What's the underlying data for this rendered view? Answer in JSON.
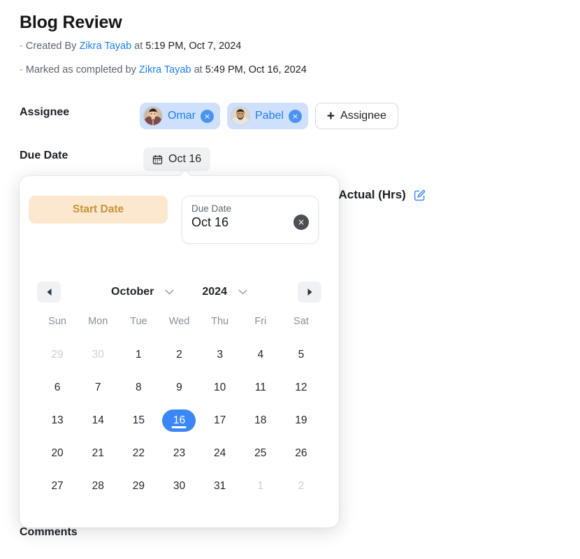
{
  "header": {
    "title": "Blog Review",
    "created": {
      "dash": "-",
      "prefix": "Created By",
      "user": "Zikra Tayab",
      "mid": "at",
      "date": "5:19 PM, Oct 7, 2024"
    },
    "completed": {
      "dash": "-",
      "prefix": "Marked as completed by",
      "user": "Zikra Tayab",
      "mid": "at",
      "date": "5:49 PM, Oct 16, 2024"
    }
  },
  "fields": {
    "assignee_label": "Assignee",
    "due_date_label": "Due Date",
    "assignees": [
      {
        "name": "Omar",
        "remove_label": "×",
        "avatar": "omar-avatar"
      },
      {
        "name": "Pabel",
        "remove_label": "×",
        "avatar": "pabel-avatar"
      }
    ],
    "add_assignee_label": "Assignee",
    "add_assignee_plus": "+",
    "due_date_value": "Oct 16"
  },
  "tracking": {
    "label": "g Actual (Hrs)",
    "edit_icon": "edit-icon"
  },
  "comments_label": "Comments",
  "datepicker": {
    "start_date_label": "Start Date",
    "due_date_card": {
      "label": "Due Date",
      "value": "Oct 16",
      "clear_label": "×"
    },
    "nav": {
      "prev_icon": "caret-left-icon",
      "next_icon": "caret-right-icon",
      "month": "October",
      "year": "2024",
      "month_chevron": "chevron-down-icon",
      "year_chevron": "chevron-down-icon"
    },
    "weekdays": [
      "Sun",
      "Mon",
      "Tue",
      "Wed",
      "Thu",
      "Fri",
      "Sat"
    ],
    "selected_day": 16,
    "weeks": [
      [
        {
          "d": "29",
          "muted": true
        },
        {
          "d": "30",
          "muted": true
        },
        {
          "d": "1"
        },
        {
          "d": "2"
        },
        {
          "d": "3"
        },
        {
          "d": "4"
        },
        {
          "d": "5"
        }
      ],
      [
        {
          "d": "6"
        },
        {
          "d": "7"
        },
        {
          "d": "8"
        },
        {
          "d": "9"
        },
        {
          "d": "10"
        },
        {
          "d": "11"
        },
        {
          "d": "12"
        }
      ],
      [
        {
          "d": "13"
        },
        {
          "d": "14"
        },
        {
          "d": "15"
        },
        {
          "d": "16",
          "selected": true
        },
        {
          "d": "17"
        },
        {
          "d": "18"
        },
        {
          "d": "19"
        }
      ],
      [
        {
          "d": "20"
        },
        {
          "d": "21"
        },
        {
          "d": "22"
        },
        {
          "d": "23"
        },
        {
          "d": "24"
        },
        {
          "d": "25"
        },
        {
          "d": "26"
        }
      ],
      [
        {
          "d": "27"
        },
        {
          "d": "28"
        },
        {
          "d": "29"
        },
        {
          "d": "30"
        },
        {
          "d": "31"
        },
        {
          "d": "1",
          "muted": true
        },
        {
          "d": "2",
          "muted": true
        }
      ]
    ]
  },
  "colors": {
    "accent_blue": "#3b87f7",
    "link_blue": "#1b7ff5",
    "chip_bg": "#cfe0fd",
    "start_date_bg": "#fce8ce",
    "start_date_fg": "#c8933a"
  }
}
